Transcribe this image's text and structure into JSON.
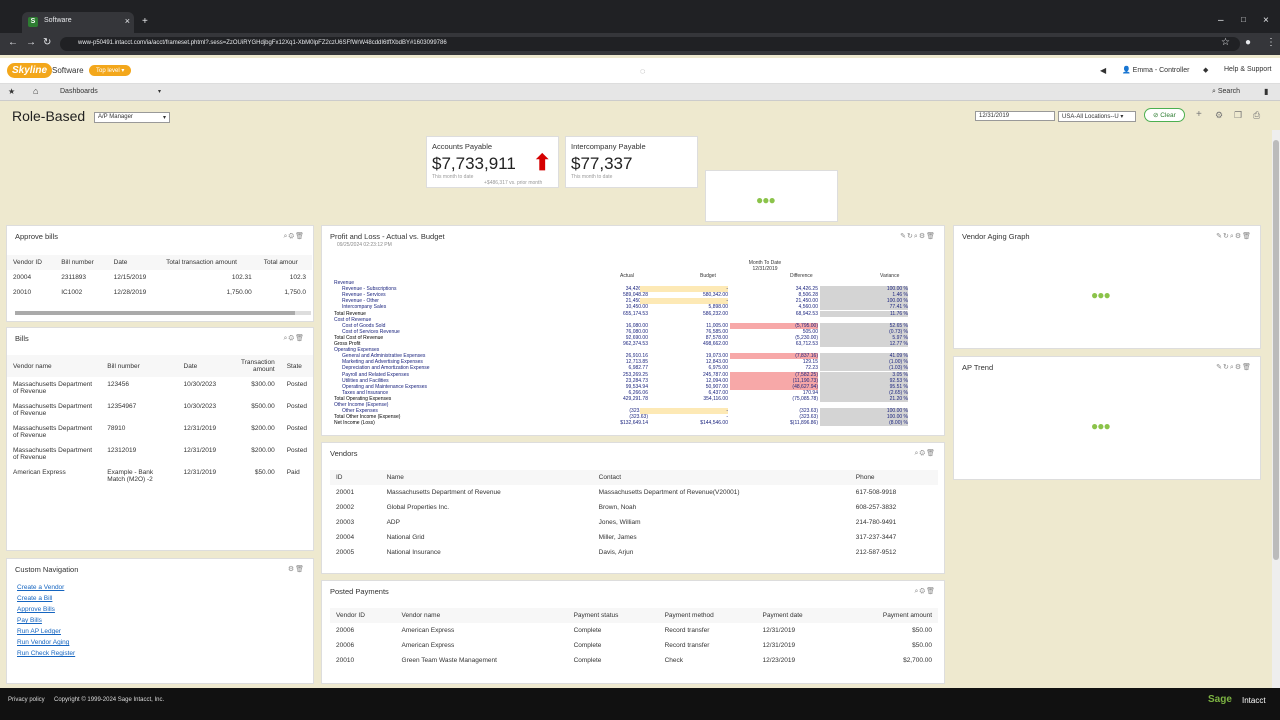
{
  "browser": {
    "tab_title": "Software",
    "url": "www-p50491.intacct.com/ia/acct/frameset.phtml?.sess=ZzOUiRYGHdjbgFx12Xq1-XbM0lpFZ2czU6SFfWrW48cddI6tffXbdBY#1603099786"
  },
  "app": {
    "logo": "Skyline",
    "company": "Software",
    "top_level": "Top level",
    "user": "Emma - Controller",
    "help": "Help & Support",
    "dashboards": "Dashboards",
    "search": "Search"
  },
  "dashboard": {
    "title": "Role-Based",
    "role": "A/P Manager",
    "date": "12/31/2019",
    "location": "USA-All Locations--U",
    "clear": "Clear"
  },
  "kpi": {
    "ap_label": "Accounts Payable",
    "ap_value": "$7,733,911",
    "ap_sub": "This month to date",
    "ap_delta": "+$486,317 vs. prior month",
    "ic_label": "Intercompany Payable",
    "ic_value": "$77,337",
    "ic_sub": "This month to date"
  },
  "approve_bills": {
    "title": "Approve bills",
    "headers": [
      "Vendor ID",
      "Bill number",
      "Date",
      "Total transaction amount",
      "Total amour"
    ],
    "rows": [
      [
        "20004",
        "2311893",
        "12/15/2019",
        "102.31",
        "102.3"
      ],
      [
        "20010",
        "IC1002",
        "12/28/2019",
        "1,750.00",
        "1,750.0"
      ]
    ]
  },
  "bills": {
    "title": "Bills",
    "headers": [
      "Vendor name",
      "Bill number",
      "Date",
      "Transaction amount",
      "State"
    ],
    "rows": [
      [
        "Massachusetts Department of Revenue",
        "123456",
        "10/30/2023",
        "$300.00",
        "Posted"
      ],
      [
        "Massachusetts Department of Revenue",
        "12354967",
        "10/30/2023",
        "$500.00",
        "Posted"
      ],
      [
        "Massachusetts Department of Revenue",
        "78910",
        "12/31/2019",
        "$200.00",
        "Posted"
      ],
      [
        "Massachusetts Department of Revenue",
        "12312019",
        "12/31/2019",
        "$200.00",
        "Posted"
      ],
      [
        "American Express",
        "Example - Bank Match (M2O) -2",
        "12/31/2019",
        "$50.00",
        "Paid"
      ]
    ]
  },
  "custom_nav": {
    "title": "Custom Navigation",
    "links": [
      "Create a Vendor",
      "Create a Bill",
      "Approve Bills",
      "Pay Bills",
      "Run AP Ledger",
      "Run Vendor Aging",
      "Run Check Register"
    ]
  },
  "pl": {
    "title": "Profit and Loss - Actual vs. Budget",
    "timestamp": "09/25/2024 02:23:12 PM",
    "period": "Month To Date",
    "period_date": "12/31/2019",
    "cols": [
      "Actual",
      "Budget",
      "Difference",
      "Variance"
    ],
    "rows": [
      [
        "Revenue",
        "",
        "",
        "",
        ""
      ],
      [
        "Revenue - Subscriptions",
        "34,426.25",
        "-",
        "34,426.25",
        "100.00 %"
      ],
      [
        "Revenue - Services",
        "589,048.28",
        "580,342.00",
        "8,506.28",
        "1.46 %"
      ],
      [
        "Revenue - Other",
        "21,450.00",
        "-",
        "21,450.00",
        "100.00 %"
      ],
      [
        "Intercompany Sales",
        "10,450.00",
        "5,898.00",
        "4,560.00",
        "77.41 %"
      ],
      [
        "Total Revenue",
        "655,174.53",
        "586,232.00",
        "68,942.53",
        "11.76 %"
      ],
      [
        "Cost of Revenue",
        "",
        "",
        "",
        ""
      ],
      [
        "Cost of Goods Sold",
        "16,080.00",
        "11,005.00",
        "(5,795.00)",
        "52.65 %"
      ],
      [
        "Cost of Services Revenue",
        "76,080.00",
        "76,585.00",
        "505.00",
        "(0.73) %"
      ],
      [
        "Total Cost of Revenue",
        "92,690.00",
        "87,578.00",
        "(5,230.00)",
        "5.97 %"
      ],
      [
        "Gross Profit",
        "962,374.53",
        "498,662.00",
        "63,712.53",
        "12.77 %"
      ],
      [
        "Operating Expenses",
        "",
        "",
        "",
        ""
      ],
      [
        "General and Administrative Expenses",
        "26,910.16",
        "19,073.00",
        "(7,837.16)",
        "41.09 %"
      ],
      [
        "Marketing and Advertising Expenses",
        "12,713.85",
        "12,843.00",
        "129.15",
        "(1.00) %"
      ],
      [
        "Depreciation and Amortization Expense",
        "6,982.77",
        "6,975.00",
        "72.23",
        "(1.03) %"
      ],
      [
        "Payroll and Related Expenses",
        "253,269.25",
        "245,787.00",
        "(7,582.25)",
        "3.05 %"
      ],
      [
        "Utilities and Facilities",
        "23,284.73",
        "12,094.00",
        "(11,190.73)",
        "92.53 %"
      ],
      [
        "Operating and Maintenance Expenses",
        "99,534.94",
        "50,907.00",
        "(48,627.94)",
        "95.51 %"
      ],
      [
        "Taxes and Insurance",
        "6,266.06",
        "6,437.00",
        "170.94",
        "(2.65) %"
      ],
      [
        "Total Operating Expenses",
        "429,291.78",
        "354,116.00",
        "(75,085.78)",
        "21.20 %"
      ],
      [
        "Other Income (Expense)",
        "",
        "",
        "",
        ""
      ],
      [
        "Other Expenses",
        "(323.63)",
        "-",
        "(323.63)",
        "100.00 %"
      ],
      [
        "Total Other Income (Expense)",
        "(323.63)",
        "-",
        "(323.63)",
        "100.00 %"
      ],
      [
        "Net Income (Loss)",
        "$132,649.14",
        "$144,546.00",
        "$(11,896.86)",
        "(8.00) %"
      ]
    ]
  },
  "vendors": {
    "title": "Vendors",
    "headers": [
      "ID",
      "Name",
      "Contact",
      "Phone"
    ],
    "rows": [
      [
        "20001",
        "Massachusetts Department of Revenue",
        "Massachusetts Department of Revenue(V20001)",
        "617-508-9918"
      ],
      [
        "20002",
        "Global Properties Inc.",
        "Brown, Noah",
        "608-257-3832"
      ],
      [
        "20003",
        "ADP",
        "Jones, William",
        "214-780-9491"
      ],
      [
        "20004",
        "National Grid",
        "Miller, James",
        "317-237-3447"
      ],
      [
        "20005",
        "National Insurance",
        "Davis, Arjun",
        "212-587-9512"
      ]
    ]
  },
  "posted": {
    "title": "Posted Payments",
    "headers": [
      "Vendor ID",
      "Vendor name",
      "Payment status",
      "Payment method",
      "Payment date",
      "Payment amount"
    ],
    "rows": [
      [
        "20006",
        "American Express",
        "Complete",
        "Record transfer",
        "12/31/2019",
        "$50.00"
      ],
      [
        "20006",
        "American Express",
        "Complete",
        "Record transfer",
        "12/31/2019",
        "$50.00"
      ],
      [
        "20010",
        "Green Team Waste Management",
        "Complete",
        "Check",
        "12/23/2019",
        "$2,700.00"
      ]
    ]
  },
  "right": {
    "aging": "Vendor Aging Graph",
    "trend": "AP Trend"
  },
  "footer": {
    "privacy": "Privacy policy",
    "copyright": "Copyright © 1999-2024 Sage Intacct, Inc.",
    "brand1": "Sage",
    "brand2": "Intacct"
  }
}
